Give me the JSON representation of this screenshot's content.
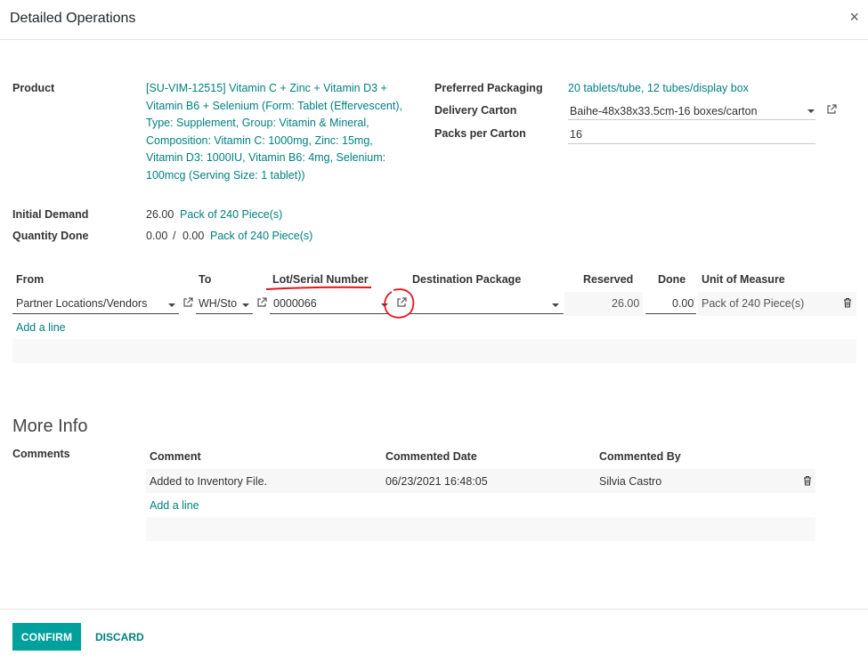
{
  "dialog": {
    "title": "Detailed Operations",
    "close_icon": "×"
  },
  "product": {
    "label": "Product",
    "value": "[SU-VIM-12515] Vitamin C + Zinc + Vitamin D3 + Vitamin B6 + Selenium (Form: Tablet (Effervescent), Type: Supplement, Group: Vitamin & Mineral, Composition: Vitamin C: 1000mg, Zinc: 15mg, Vitamin D3: 1000IU, Vitamin B6: 4mg, Selenium: 100mcg (Serving Size: 1 tablet))"
  },
  "initial_demand": {
    "label": "Initial Demand",
    "qty": "26.00",
    "uom": "Pack of 240 Piece(s)"
  },
  "quantity_done": {
    "label": "Quantity Done",
    "done": "0.00",
    "sep": "/",
    "total": "0.00",
    "uom": "Pack of 240 Piece(s)"
  },
  "packaging": {
    "preferred_label": "Preferred Packaging",
    "preferred_value": "20 tablets/tube, 12 tubes/display box",
    "carton_label": "Delivery Carton",
    "carton_value": "Baihe-48x38x33.5cm-16 boxes/carton",
    "packs_label": "Packs per Carton",
    "packs_value": "16"
  },
  "lines_table": {
    "headers": {
      "from": "From",
      "to": "To",
      "lot": "Lot/Serial Number",
      "dest": "Destination Package",
      "reserved": "Reserved",
      "done": "Done",
      "uom": "Unit of Measure"
    },
    "row": {
      "from": "Partner Locations/Vendors",
      "to": "WH/Sto",
      "lot": "0000066",
      "dest": "",
      "reserved": "26.00",
      "done": "0.00",
      "uom": "Pack of 240 Piece(s)"
    },
    "add_line": "Add a line"
  },
  "more_info": {
    "title": "More Info",
    "comments_label": "Comments",
    "headers": {
      "comment": "Comment",
      "date": "Commented Date",
      "by": "Commented By"
    },
    "rows": [
      {
        "comment": "Added to Inventory File.",
        "date": "06/23/2021 16:48:05",
        "by": "Silvia Castro"
      }
    ],
    "add_line": "Add a line"
  },
  "footer": {
    "confirm": "CONFIRM",
    "discard": "DISCARD"
  },
  "colors": {
    "accent": "#00a09d",
    "link": "#00807d",
    "annotation": "#e8141b"
  }
}
